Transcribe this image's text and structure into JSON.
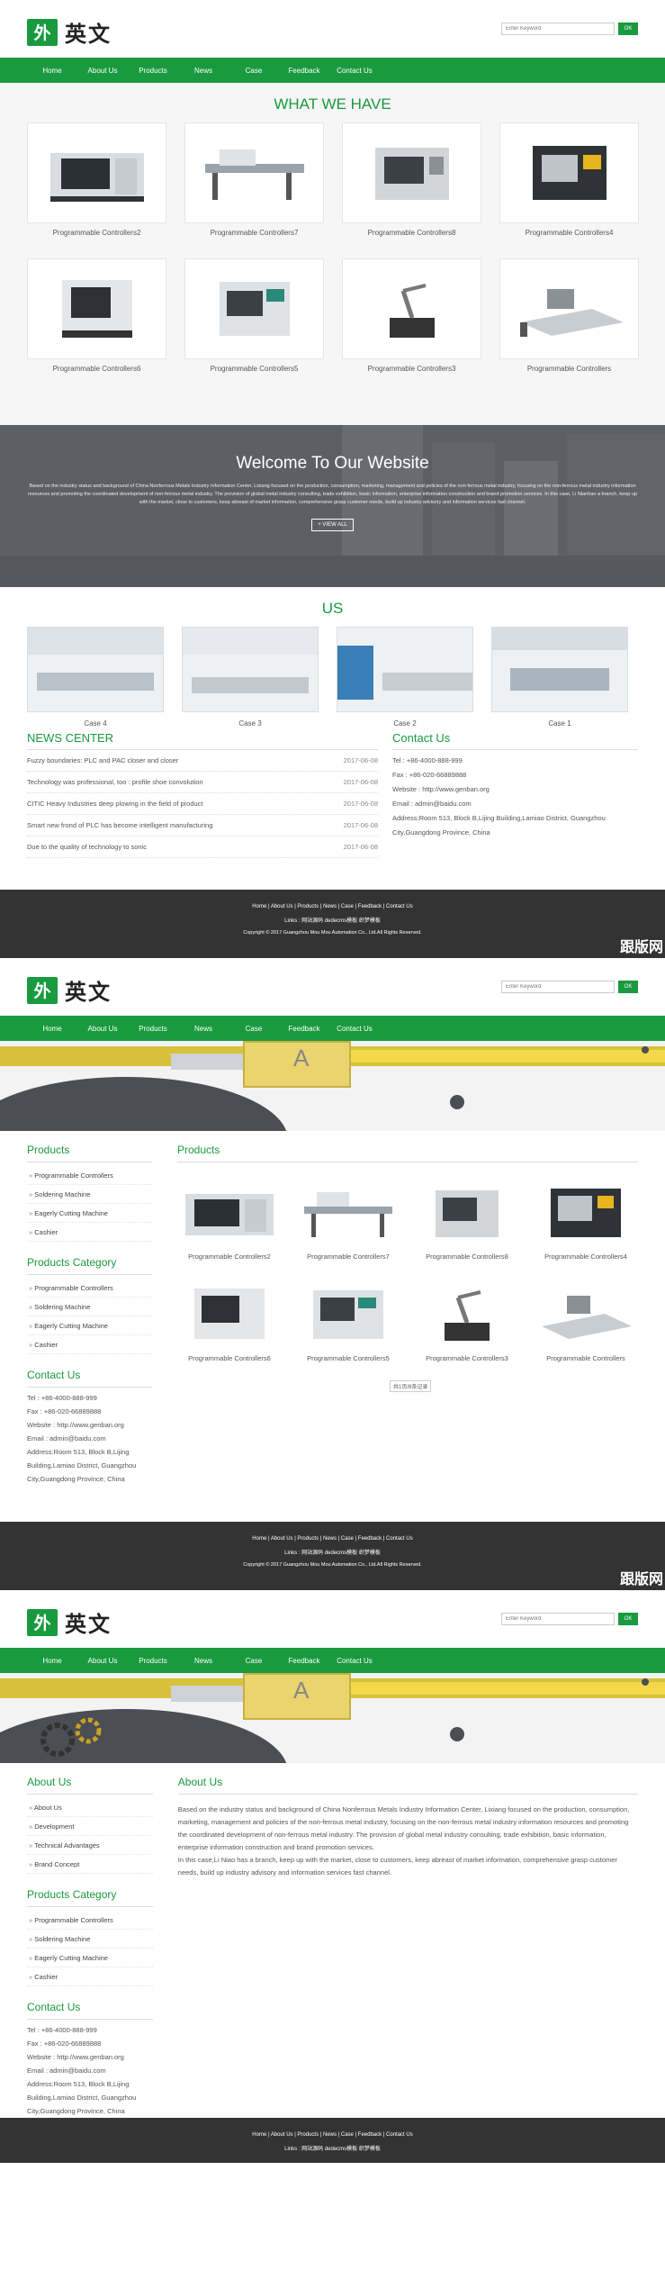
{
  "brand": {
    "logo_mark": "外",
    "logo_text": "英文",
    "color": "#1a9a3f"
  },
  "search": {
    "placeholder": "Enter Keyword",
    "button": "OK"
  },
  "nav": [
    "Home",
    "About Us",
    "Products",
    "News",
    "Case",
    "Feedback",
    "Contact Us"
  ],
  "home": {
    "what_we_have": "WHAT WE HAVE",
    "products": [
      "Programmable Controllers2",
      "Programmable Controllers7",
      "Programmable Controllers8",
      "Programmable Controllers4",
      "Programmable Controllers6",
      "Programmable Controllers5",
      "Programmable Controllers3",
      "Programmable Controllers"
    ],
    "welcome_title": "Welcome To Our Website",
    "welcome_text": "Based on the industry status and background of China Nonferrous Metals Industry Information Center, Lixiang focused on the production, consumption, marketing, management and policies of the non-ferrous metal industry, focusing on the non-ferrous metal industry information resources and promoting the coordinated development of non-ferrous metal industry. The provision of global metal industry consulting, trade exhibition, basic information, enterprise information construction and brand promotion services. In this case, Li Nianhao a branch, keep up with the market, close to customers, keep abreast of market information, comprehensive grasp customer needs, build up industry advisory and information services fast channel.",
    "view_all": "+ VIEW ALL",
    "us_title": "US",
    "cases": [
      "Case 4",
      "Case 3",
      "Case 2",
      "Case 1"
    ],
    "news_title": "NEWS CENTER",
    "news": [
      {
        "title": "Fuzzy boundaries: PLC and PAC closer and closer",
        "date": "2017-06-08"
      },
      {
        "title": "Technology was professional, too : profile shoe convolution",
        "date": "2017-06-08"
      },
      {
        "title": "CITIC Heavy Industries deep plowing in the field of product",
        "date": "2017-06-08"
      },
      {
        "title": "Smart new frond of PLC has become intelligent manufacturing",
        "date": "2017-06-08"
      },
      {
        "title": "Due to the quality of technology to sonic",
        "date": "2017-06-08"
      }
    ]
  },
  "contact": {
    "title": "Contact Us",
    "tel": "Tel : +86-4000-888-999",
    "fax": "Fax : +86-020-66889888",
    "website": "Website : http://www.genban.org",
    "email": "Email : admin@baidu.com",
    "address": "Address:Room 513, Block B,Lijing Building,Lamiao District, Guangzhou City,Guangdong Province, China"
  },
  "footer": {
    "links": "Home  |  About Us  |  Products  |  News  |  Case  |  Feedback  |  Contact Us",
    "links2": "Links :  网站源码   dedecms模板   织梦模板",
    "copyright": "Copyright © 2017 Guangzhou Mou Mou Automation Co., Ltd.All Rights Reserved.",
    "watermark": "跟版网"
  },
  "products_page": {
    "side_products_title": "Products",
    "side_products": [
      "Programmable Controllers",
      "Soldering Machine",
      "Eagerly Cutting Machine",
      "Cashier"
    ],
    "category_title": "Products Category",
    "category": [
      "Programmable Controllers",
      "Soldering Machine",
      "Eagerly Cutting Machine",
      "Cashier"
    ],
    "main_title": "Products",
    "pager": "共1页/8条记录"
  },
  "about_page": {
    "side_title": "About Us",
    "side_items": [
      "About Us",
      "Development",
      "Technical Advantages",
      "Brand Concept"
    ],
    "main_title": "About Us",
    "text1": "Based on the industry status and background of China Nonferrous Metals Industry Information Center, Lixiang focused on the production, consumption, marketing, management and policies of the non-ferrous metal industry, focusing on the non-ferrous metal industry information resources and promoting the coordinated development of non-ferrous metal industry. The provision of global metal industry consulting, trade exhibition, basic information, enterprise information construction and brand promotion services.",
    "text2": "In this case,Li Niao has a branch, keep up with the market, close to customers, keep abreast of market information, comprehensive grasp customer needs, build up industry advisory and information services fast channel."
  }
}
